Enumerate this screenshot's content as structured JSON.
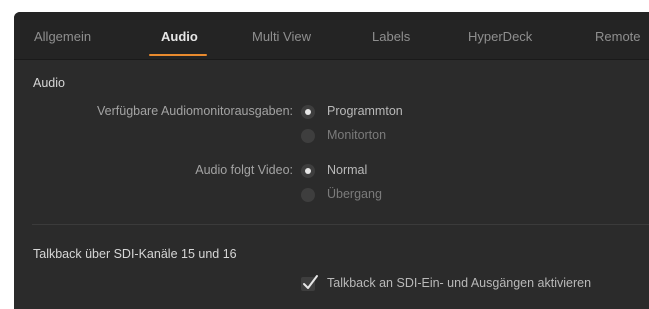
{
  "tabs": [
    {
      "label": "Allgemein"
    },
    {
      "label": "Audio"
    },
    {
      "label": "Multi View"
    },
    {
      "label": "Labels"
    },
    {
      "label": "HyperDeck"
    },
    {
      "label": "Remote"
    }
  ],
  "active_tab": "Audio",
  "accent_color": "#e98a2e",
  "audio": {
    "section_title": "Audio",
    "monitor_outputs": {
      "label": "Verfügbare Audiomonitorausgaben:",
      "options": [
        {
          "label": "Programmton",
          "selected": true
        },
        {
          "label": "Monitorton",
          "selected": false
        }
      ]
    },
    "follow_video": {
      "label": "Audio folgt Video:",
      "options": [
        {
          "label": "Normal",
          "selected": true
        },
        {
          "label": "Übergang",
          "selected": false
        }
      ]
    }
  },
  "talkback": {
    "section_title": "Talkback über SDI-Kanäle 15 und 16",
    "checkbox": {
      "label": "Talkback an SDI-Ein- und Ausgängen aktivieren",
      "checked": true,
      "icon": "checkmark-icon"
    }
  }
}
